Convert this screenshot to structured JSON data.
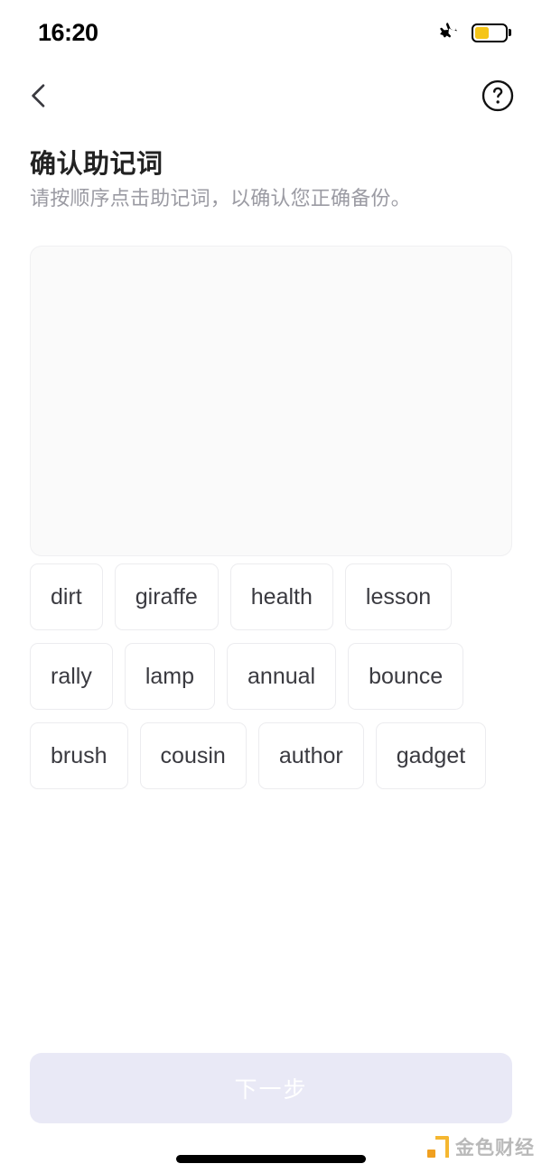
{
  "status_bar": {
    "time": "16:20",
    "airplane_icon": "airplane-mode-icon",
    "battery_icon": "battery-icon",
    "battery_level_percent": 48,
    "battery_color": "#f5c518"
  },
  "nav": {
    "back_icon": "chevron-left-icon",
    "help_icon": "question-mark-circle-icon"
  },
  "header": {
    "title": "确认助记词",
    "subtitle": "请按顺序点击助记词，以确认您正确备份。"
  },
  "answer_panel": {
    "selected_words": [],
    "background_color": "#fafafa"
  },
  "word_bank": {
    "words": [
      "dirt",
      "giraffe",
      "health",
      "lesson",
      "rally",
      "lamp",
      "annual",
      "bounce",
      "brush",
      "cousin",
      "author",
      "gadget"
    ]
  },
  "footer": {
    "next_label": "下一步",
    "next_disabled": true,
    "next_bg_color": "#e9e9f6"
  },
  "watermark": {
    "text": "金色财经",
    "logo_color": "#f5b731"
  }
}
